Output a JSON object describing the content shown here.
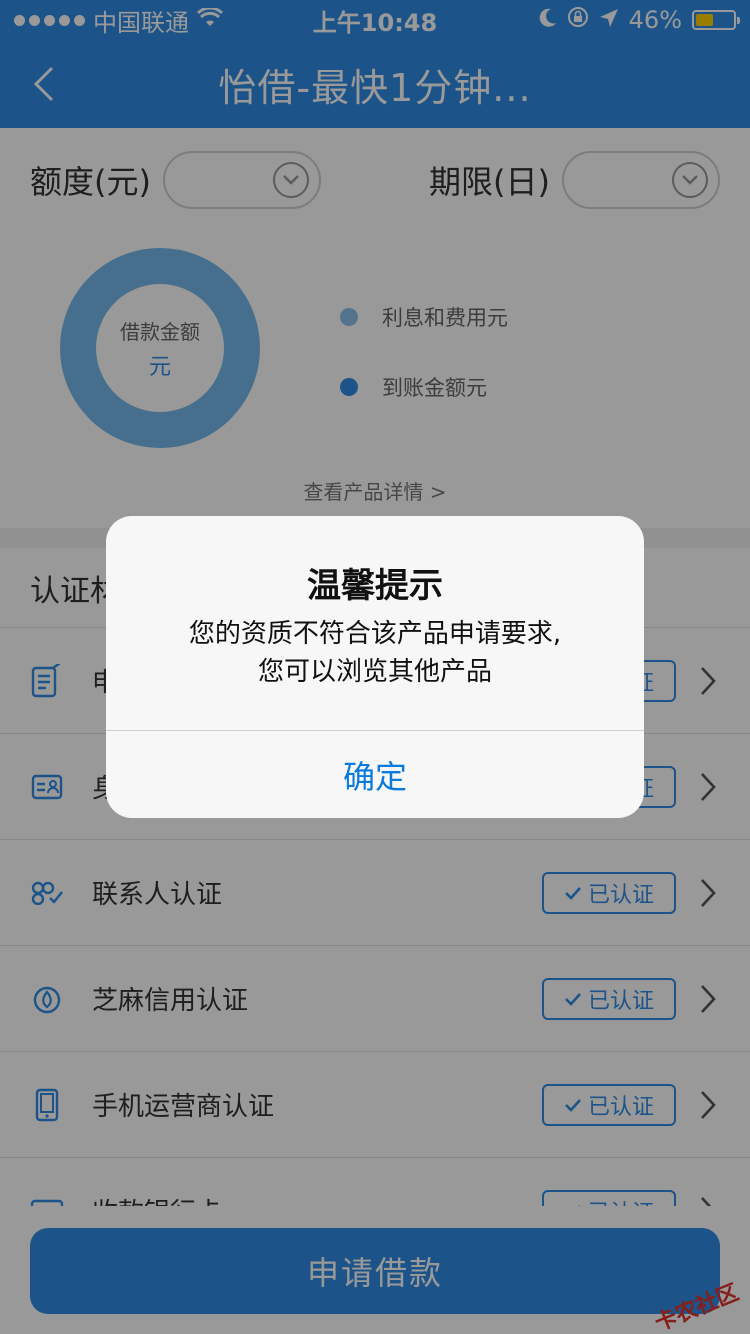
{
  "status_bar": {
    "carrier": "中国联通",
    "time": "上午10:48",
    "battery": "46%",
    "battery_level": 0.46
  },
  "nav": {
    "title": "怡借-最快1分钟..."
  },
  "filters": {
    "amount_label": "额度(元)",
    "term_label": "期限(日)"
  },
  "chart": {
    "center_label": "借款金额",
    "center_unit": "元",
    "legend": [
      {
        "label": "利息和费用元",
        "color": "#8ec2ea"
      },
      {
        "label": "到账金额元",
        "color": "#2f8ce4"
      }
    ],
    "detail_link": "查看产品详情 >"
  },
  "verification": {
    "section_title": "认证材料",
    "items": [
      {
        "label": "申请资料认证",
        "status": "已认证",
        "icon": "document-edit-icon"
      },
      {
        "label": "身份信息认证",
        "status": "已认证",
        "icon": "id-card-icon"
      },
      {
        "label": "联系人认证",
        "status": "已认证",
        "icon": "contacts-icon"
      },
      {
        "label": "芝麻信用认证",
        "status": "已认证",
        "icon": "sesame-credit-icon"
      },
      {
        "label": "手机运营商认证",
        "status": "已认证",
        "icon": "mobile-phone-icon"
      },
      {
        "label": "收款银行卡",
        "status": "已认证",
        "icon": "bank-card-icon"
      }
    ]
  },
  "footer": {
    "apply_label": "申请借款",
    "watermark": "卡农社区"
  },
  "alert": {
    "title": "温馨提示",
    "message_line1": "您的资质不符合该产品申请要求,",
    "message_line2": "您可以浏览其他产品",
    "confirm_label": "确定"
  },
  "colors": {
    "accent": "#2f8ce4",
    "alert_button": "#0a7bdd"
  }
}
